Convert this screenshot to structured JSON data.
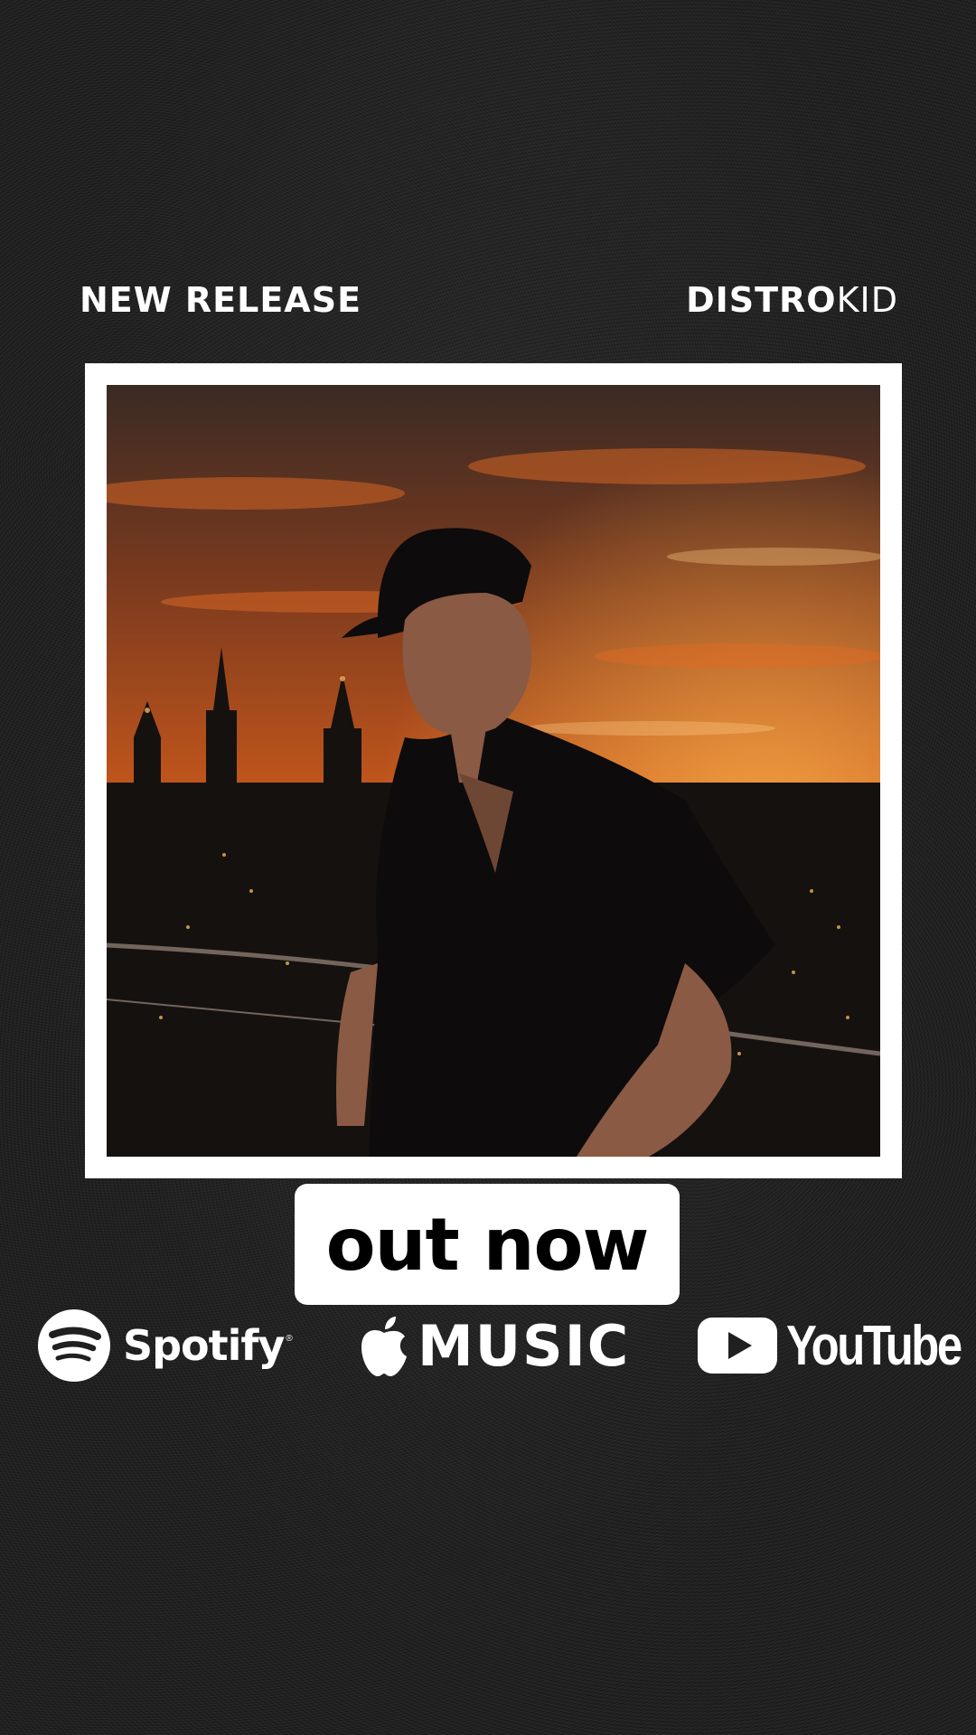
{
  "header": {
    "left_label": "NEW RELEASE",
    "brand_bold": "DISTRO",
    "brand_light": "KID"
  },
  "artwork": {
    "icon": "album-cover-photo",
    "description_colors": {
      "sky_top": "#3a2a24",
      "sky_mid": "#c8581c",
      "sky_glow": "#f08a2a",
      "city": "#15110f"
    }
  },
  "cta": {
    "label": "out now"
  },
  "platforms": [
    {
      "name": "Spotify",
      "icon": "spotify-icon",
      "reg": "®"
    },
    {
      "name": "MUSIC",
      "icon": "apple-icon"
    },
    {
      "name": "YouTube",
      "icon": "youtube-play-icon"
    }
  ]
}
